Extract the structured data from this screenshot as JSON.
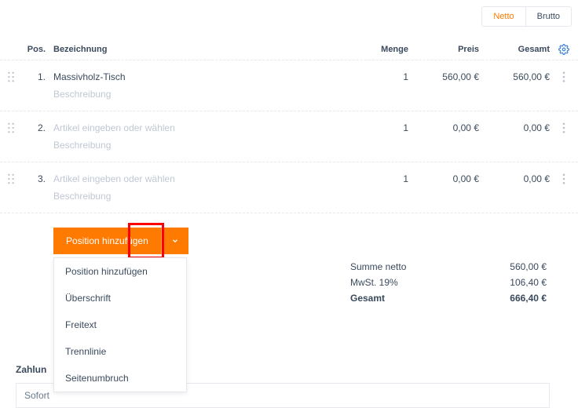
{
  "tabs": {
    "netto": "Netto",
    "brutto": "Brutto"
  },
  "header": {
    "pos": "Pos.",
    "name": "Bezeichnung",
    "qty": "Menge",
    "price": "Preis",
    "total": "Gesamt"
  },
  "items": [
    {
      "pos": "1.",
      "name": "Massivholz-Tisch",
      "placeholder": false,
      "qty": "1",
      "price": "560,00 €",
      "total": "560,00 €",
      "desc": "Beschreibung"
    },
    {
      "pos": "2.",
      "name": "Artikel eingeben oder wählen",
      "placeholder": true,
      "qty": "1",
      "price": "0,00 €",
      "total": "0,00 €",
      "desc": "Beschreibung"
    },
    {
      "pos": "3.",
      "name": "Artikel eingeben oder wählen",
      "placeholder": true,
      "qty": "1",
      "price": "0,00 €",
      "total": "0,00 €",
      "desc": "Beschreibung"
    }
  ],
  "addButton": "Position hinzufügen",
  "dropdown": {
    "item0": "Position hinzufügen",
    "item1": "Überschrift",
    "item2": "Freitext",
    "item3": "Trennlinie",
    "item4": "Seitenumbruch"
  },
  "totals": {
    "nettoLabel": "Summe netto",
    "nettoValue": "560,00 €",
    "vatLabel": "MwSt. 19%",
    "vatValue": "106,40 €",
    "totalLabel": "Gesamt",
    "totalValue": "666,40 €"
  },
  "payment": {
    "label": "Zahlun",
    "select": "Sofort"
  }
}
